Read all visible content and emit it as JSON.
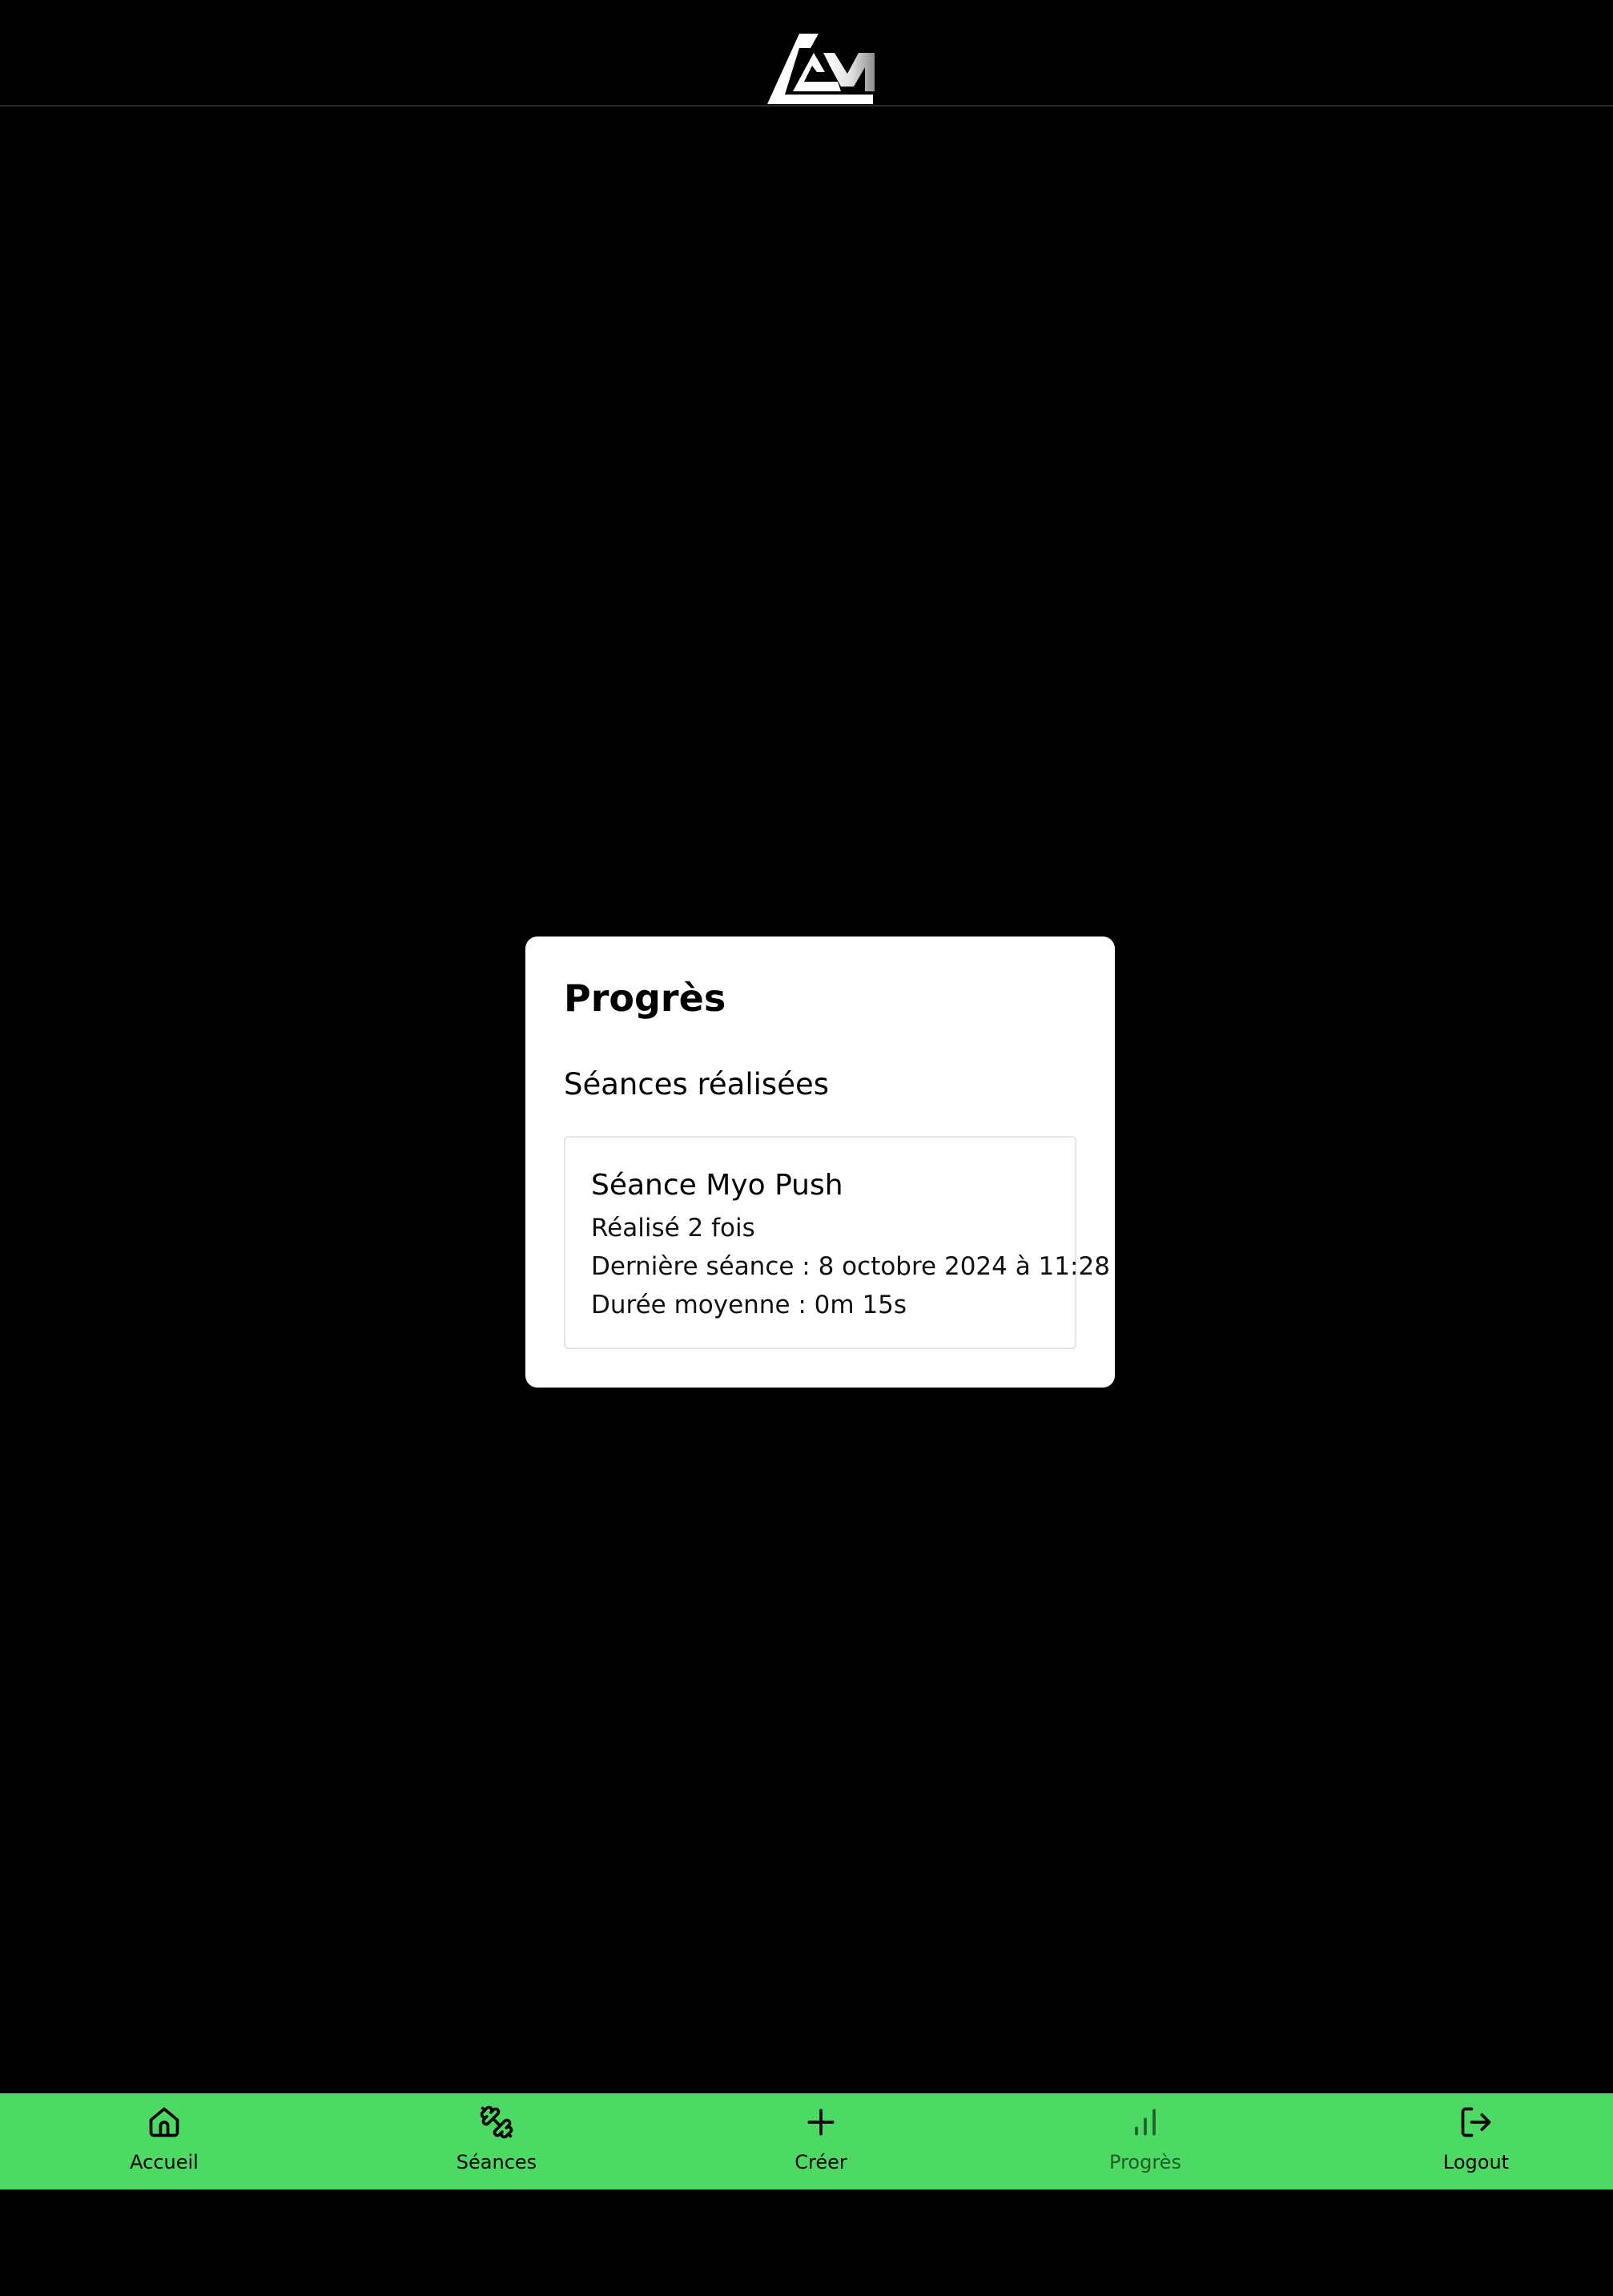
{
  "header": {
    "logo_icon": "brand-logo-icon"
  },
  "card": {
    "title": "Progrès",
    "section_title": "Séances réalisées",
    "session": {
      "name": "Séance Myo Push",
      "times_done": "Réalisé 2 fois",
      "last_session": "Dernière séance : 8 octobre 2024 à 11:28",
      "avg_duration": "Durée moyenne : 0m 15s"
    }
  },
  "nav": {
    "items": [
      {
        "label": "Accueil",
        "icon": "home-icon"
      },
      {
        "label": "Séances",
        "icon": "dumbbell-icon"
      },
      {
        "label": "Créer",
        "icon": "plus-icon"
      },
      {
        "label": "Progrès",
        "icon": "bar-chart-icon",
        "active": true
      },
      {
        "label": "Logout",
        "icon": "logout-icon"
      }
    ],
    "background_color": "#4cd964",
    "active_color": "#1e5e2a"
  }
}
